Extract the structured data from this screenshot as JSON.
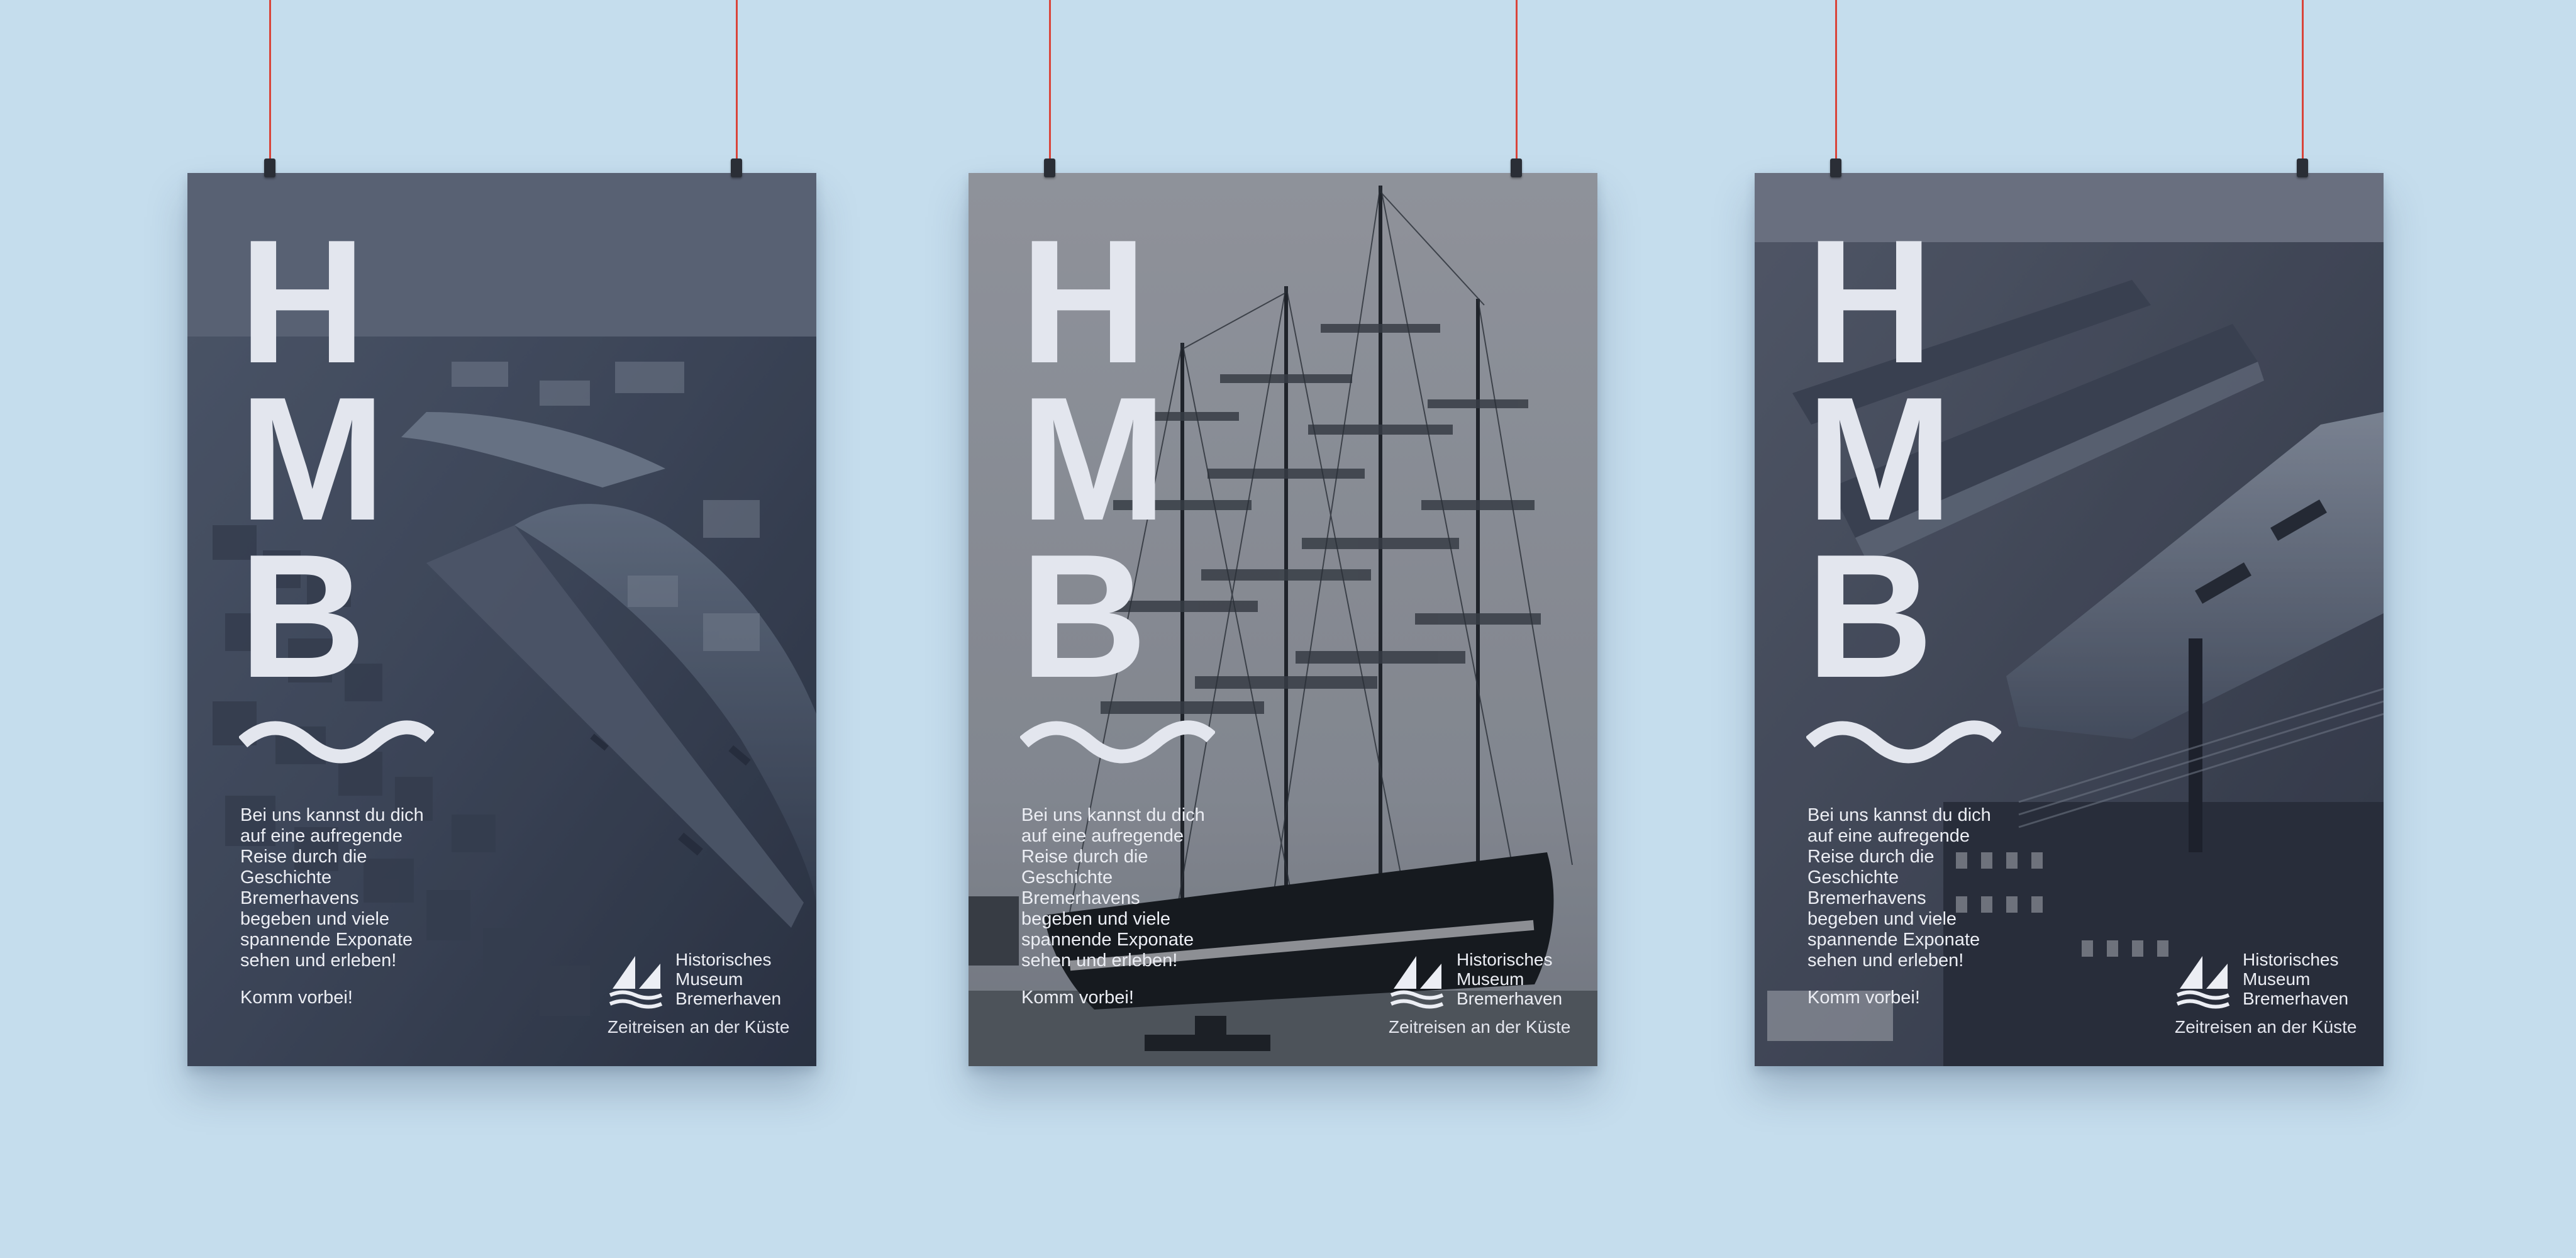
{
  "scene": {
    "background_color": "#c5dded",
    "cord_color": "#d9443a"
  },
  "posters": [
    {
      "photo": "aerial-harbor-model",
      "letters": [
        "H",
        "M",
        "B"
      ],
      "body": [
        "Bei uns kannst du dich",
        "auf eine aufregende",
        "Reise durch die",
        "Geschichte",
        "Bremerhavens",
        "begeben und viele",
        "spannende Exponate",
        "sehen und erleben!"
      ],
      "cta": "Komm vorbei!",
      "logo_name": [
        "Historisches",
        "Museum",
        "Bremerhaven"
      ],
      "tagline": "Zeitreisen an der Küste"
    },
    {
      "photo": "tall-ship",
      "letters": [
        "H",
        "M",
        "B"
      ],
      "body": [
        "Bei uns kannst du dich",
        "auf eine aufregende",
        "Reise durch die",
        "Geschichte",
        "Bremerhavens",
        "begeben und viele",
        "spannende Exponate",
        "sehen und erleben!"
      ],
      "cta": "Komm vorbei!",
      "logo_name": [
        "Historisches",
        "Museum",
        "Bremerhaven"
      ],
      "tagline": "Zeitreisen an der Küste"
    },
    {
      "photo": "historic-port-aerial",
      "letters": [
        "H",
        "M",
        "B"
      ],
      "body": [
        "Bei uns kannst du dich",
        "auf eine aufregende",
        "Reise durch die",
        "Geschichte",
        "Bremerhavens",
        "begeben und viele",
        "spannende Exponate",
        "sehen und erleben!"
      ],
      "cta": "Komm vorbei!",
      "logo_name": [
        "Historisches",
        "Museum",
        "Bremerhaven"
      ],
      "tagline": "Zeitreisen an der Küste"
    }
  ]
}
